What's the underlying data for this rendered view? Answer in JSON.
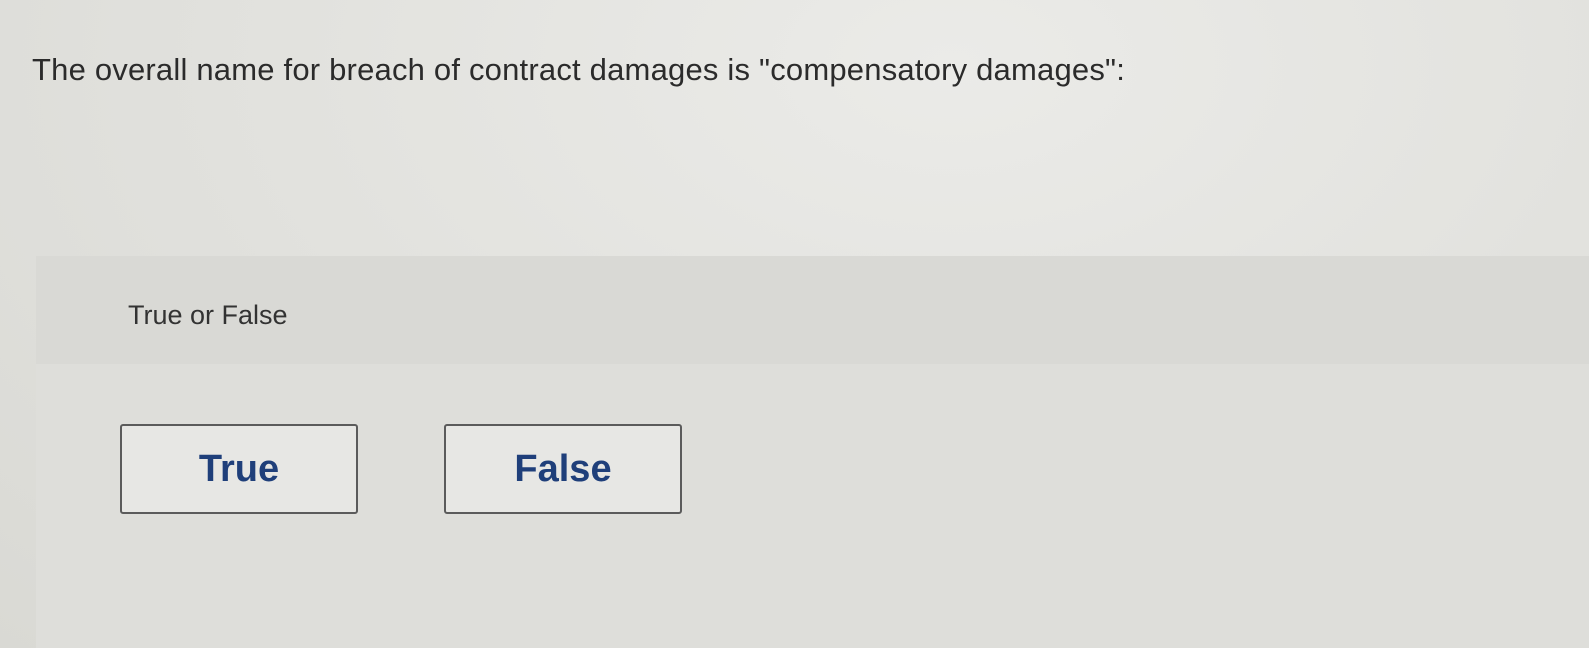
{
  "question": {
    "text": "The overall name for breach of contract damages is \"compensatory damages\":"
  },
  "answer_area": {
    "prompt": "True or False",
    "choices": [
      {
        "label": "True"
      },
      {
        "label": "False"
      }
    ]
  },
  "colors": {
    "choice_text": "#1f3f7a",
    "choice_border": "#5b5b5b"
  }
}
